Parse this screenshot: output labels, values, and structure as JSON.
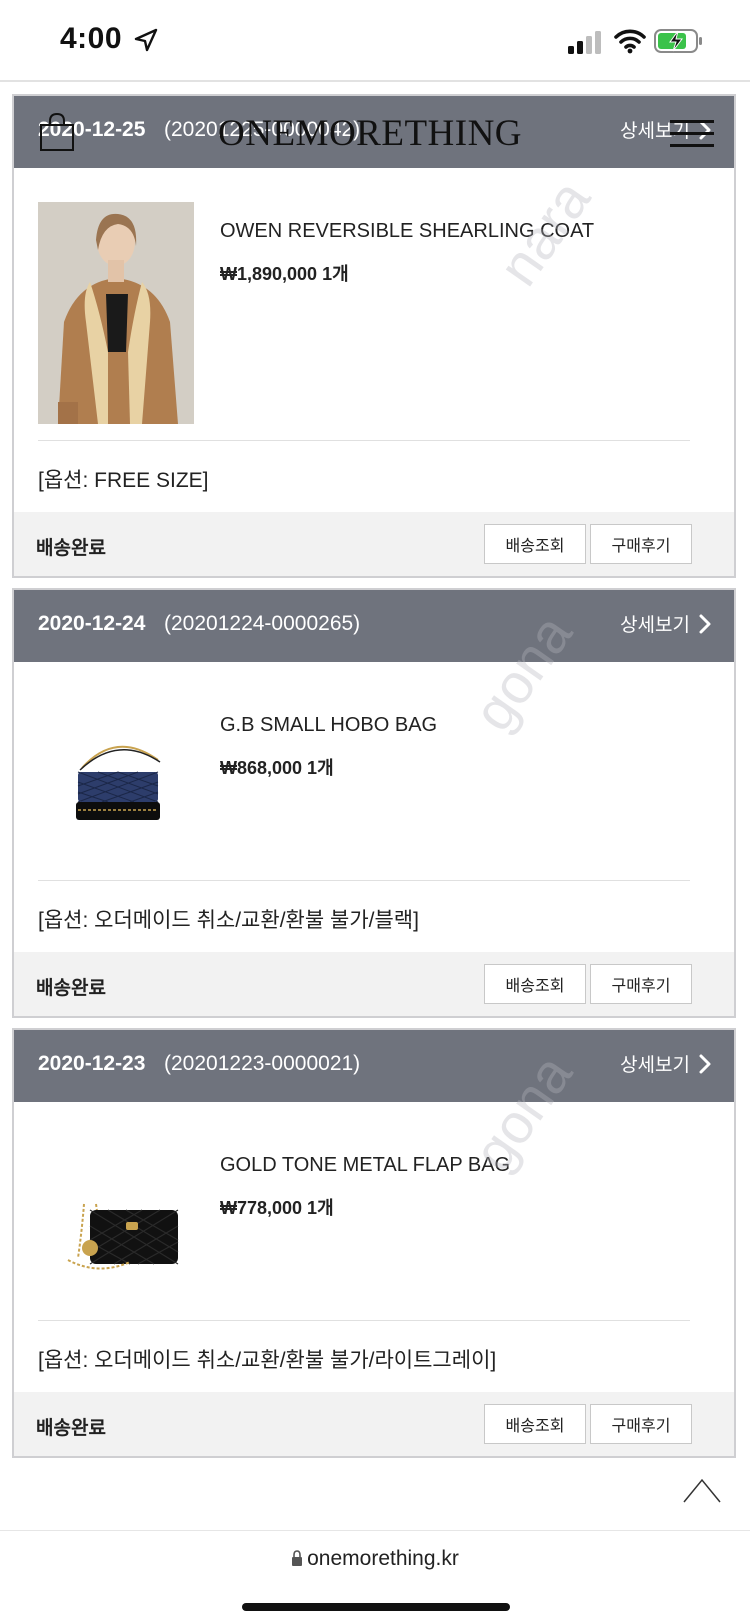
{
  "status_bar": {
    "time": "4:00"
  },
  "header": {
    "brand": "ONEMORETHING"
  },
  "orders": [
    {
      "date": "2020-12-25",
      "order_no": "(20201225-0000042)",
      "detail_label": "상세보기",
      "product_name": "OWEN REVERSIBLE SHEARLING COAT",
      "price_qty": "₩1,890,000 1개",
      "option": "[옵션: FREE SIZE]",
      "status": "배송완료",
      "track_label": "배송조회",
      "review_label": "구매후기"
    },
    {
      "date": "2020-12-24",
      "order_no": "(20201224-0000265)",
      "detail_label": "상세보기",
      "product_name": "G.B SMALL HOBO BAG",
      "price_qty": "₩868,000 1개",
      "option": "[옵션: 오더메이드 취소/교환/환불 불가/블랙]",
      "status": "배송완료",
      "track_label": "배송조회",
      "review_label": "구매후기"
    },
    {
      "date": "2020-12-23",
      "order_no": "(20201223-0000021)",
      "detail_label": "상세보기",
      "product_name": "GOLD TONE METAL FLAP BAG",
      "price_qty": "₩778,000 1개",
      "option": "[옵션: 오더메이드 취소/교환/환불 불가/라이트그레이]",
      "status": "배송완료",
      "track_label": "배송조회",
      "review_label": "구매후기"
    }
  ],
  "url_bar": {
    "url": "onemorething.kr"
  },
  "colors": {
    "order_header": "#6f737d",
    "footer_bg": "#f2f2f2"
  }
}
